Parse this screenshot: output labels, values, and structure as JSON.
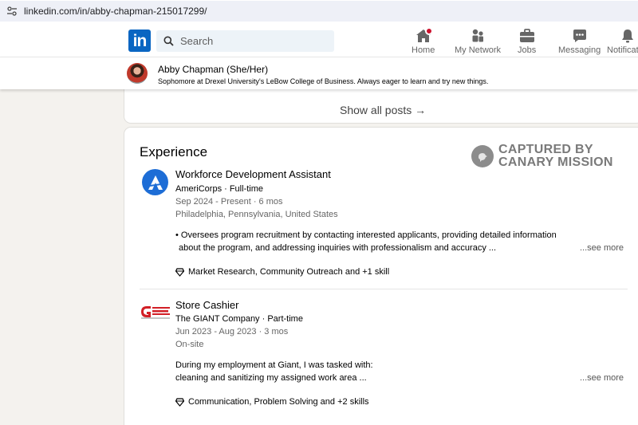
{
  "browser": {
    "url": "linkedin.com/in/abby-chapman-215017299/"
  },
  "nav": {
    "logo_text": "in",
    "search_placeholder": "Search",
    "items": [
      {
        "label": "Home",
        "icon": "home-icon"
      },
      {
        "label": "My Network",
        "icon": "network-icon"
      },
      {
        "label": "Jobs",
        "icon": "briefcase-icon"
      },
      {
        "label": "Messaging",
        "icon": "messaging-icon"
      },
      {
        "label": "Notifications",
        "icon": "bell-icon"
      }
    ],
    "accent_color": "#0a66c2",
    "notification_color": "#cb112d"
  },
  "profile": {
    "name": "Abby Chapman",
    "pronouns": "(She/Her)",
    "name_line": "Abby Chapman (She/Her)",
    "headline": "Sophomore at Drexel University's LeBow College of Business. Always eager to learn and try new things."
  },
  "posts": {
    "show_all_label": "Show all posts →"
  },
  "watermark": {
    "line1": "CAPTURED BY",
    "line2": "CANARY MISSION"
  },
  "experience": {
    "title": "Experience",
    "jobs": [
      {
        "title": "Workforce Development Assistant",
        "company": "AmeriCorps · Full-time",
        "dates": "Sep 2024 - Present · 6 mos",
        "location": "Philadelphia, Pennsylvania, United States",
        "desc_line1": "• Oversees program recruitment by contacting interested applicants, providing detailed information",
        "desc_line2": "about the program, and addressing inquiries with professionalism and accuracy ...",
        "see_more": "...see more",
        "skills": "Market Research, Community Outreach and +1 skill"
      },
      {
        "title": "Store Cashier",
        "company": "The GIANT Company · Part-time",
        "dates": "Jun 2023 - Aug 2023 · 3 mos",
        "location": "On-site",
        "desc_line1": "During my employment at Giant, I was tasked with:",
        "desc_line2": "cleaning and sanitizing my assigned work area ...",
        "see_more": "...see more",
        "skills": "Communication, Problem Solving and +2 skills",
        "logo_text": "The GIANT Company"
      }
    ]
  }
}
